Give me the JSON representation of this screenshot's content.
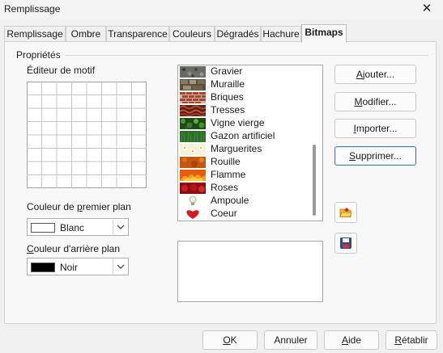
{
  "window": {
    "title": "Remplissage",
    "close_icon": "✕"
  },
  "tabs": [
    {
      "label": "Remplissage",
      "active": false
    },
    {
      "label": "Ombre",
      "active": false
    },
    {
      "label": "Transparence",
      "active": false
    },
    {
      "label": "Couleurs",
      "active": false
    },
    {
      "label": "Dégradés",
      "active": false
    },
    {
      "label": "Hachure",
      "active": false
    },
    {
      "label": "Bitmaps",
      "active": true
    }
  ],
  "properties": {
    "group_label": "Propriétés",
    "pattern_editor_label": "Éditeur de motif",
    "foreground": {
      "label_pre": "Couleur de ",
      "label_mn": "p",
      "label_post": "remier plan",
      "value": "Blanc",
      "swatch_color": "#ffffff"
    },
    "background": {
      "label_pre": "",
      "label_mn": "C",
      "label_post": "ouleur d'arrière plan",
      "value": "Noir",
      "swatch_color": "#000000"
    }
  },
  "bitmaps": [
    {
      "label": "Gravier",
      "icon": "gravel-thumb"
    },
    {
      "label": "Muraille",
      "icon": "wall-thumb"
    },
    {
      "label": "Briques",
      "icon": "bricks-thumb"
    },
    {
      "label": "Tresses",
      "icon": "braids-thumb"
    },
    {
      "label": "Vigne vierge",
      "icon": "vine-thumb"
    },
    {
      "label": "Gazon artificiel",
      "icon": "turf-thumb"
    },
    {
      "label": "Marguerites",
      "icon": "daisies-thumb"
    },
    {
      "label": "Rouille",
      "icon": "rust-thumb"
    },
    {
      "label": "Flamme",
      "icon": "flame-thumb"
    },
    {
      "label": "Roses",
      "icon": "roses-thumb"
    },
    {
      "label": "Ampoule",
      "icon": "bulb-thumb"
    },
    {
      "label": "Coeur",
      "icon": "heart-thumb"
    }
  ],
  "actions": {
    "add": {
      "pre": "",
      "mn": "A",
      "post": "jouter..."
    },
    "modify": {
      "pre": "",
      "mn": "M",
      "post": "odifier..."
    },
    "import": {
      "pre": "",
      "mn": "I",
      "post": "mporter..."
    },
    "delete": {
      "pre": "",
      "mn": "S",
      "post": "upprimer..."
    }
  },
  "icon_buttons": {
    "load": "open-folder-icon",
    "save": "save-disk-icon"
  },
  "footer": {
    "ok": {
      "pre": "",
      "mn": "O",
      "post": "K"
    },
    "cancel": {
      "pre": "",
      "mn": "",
      "post": "Annuler"
    },
    "help": {
      "pre": "",
      "mn": "A",
      "post": "ide"
    },
    "reset": {
      "pre": "",
      "mn": "R",
      "post": "établir"
    }
  },
  "colors": {
    "focus_border": "#4a7bb7",
    "panel_bg": "#f8f8f8",
    "window_bg": "#f0f0f0"
  }
}
